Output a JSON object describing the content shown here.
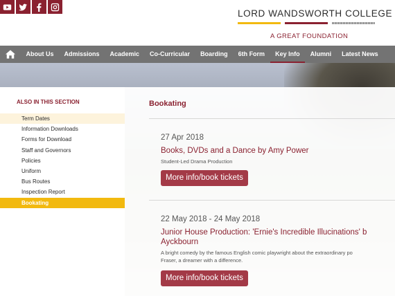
{
  "social": {
    "icons": [
      "youtube-icon",
      "twitter-icon",
      "facebook-icon",
      "instagram-icon"
    ],
    "color": "#8a2130"
  },
  "logo": {
    "title": "LORD WANDSWORTH COLLEGE",
    "tagline": "A GREAT FOUNDATION",
    "bar_colors": [
      "#f2b90f",
      "#8a2130",
      "#9a9a9a"
    ]
  },
  "nav": {
    "home_icon": "home-icon",
    "items": [
      "About Us",
      "Admissions",
      "Academic",
      "Co-Curricular",
      "Boarding",
      "6th Form",
      "Key Info",
      "Alumni",
      "Latest News"
    ],
    "active": "Key Info"
  },
  "sidebar": {
    "heading": "ALSO IN THIS SECTION",
    "items": [
      "Term Dates",
      "Information Downloads",
      "Forms for Download",
      "Staff and Governors",
      "Policies",
      "Uniform",
      "Bus Routes",
      "Inspection Report",
      "Bookating"
    ],
    "active": "Bookating"
  },
  "main": {
    "title": "Bookating",
    "events": [
      {
        "date": "27 Apr 2018",
        "title": "Books, DVDs and a Dance by Amy Power",
        "desc": "Student-Led Drama Production",
        "button": "More info/book tickets"
      },
      {
        "date": "22 May 2018 - 24 May 2018",
        "title": "Junior House Production: 'Ernie's Incredible Illucinations' b",
        "title2": "Ayckbourn",
        "desc": "A bright comedy by the famous English comic playwright about the extraordinary po",
        "desc2": "Fraser, a dreamer with a difference.",
        "button": "More info/book tickets"
      }
    ]
  },
  "colors": {
    "brand": "#8a2130",
    "accent": "#f2b90f",
    "nav_bg": "#737373",
    "button": "#a33a47"
  }
}
